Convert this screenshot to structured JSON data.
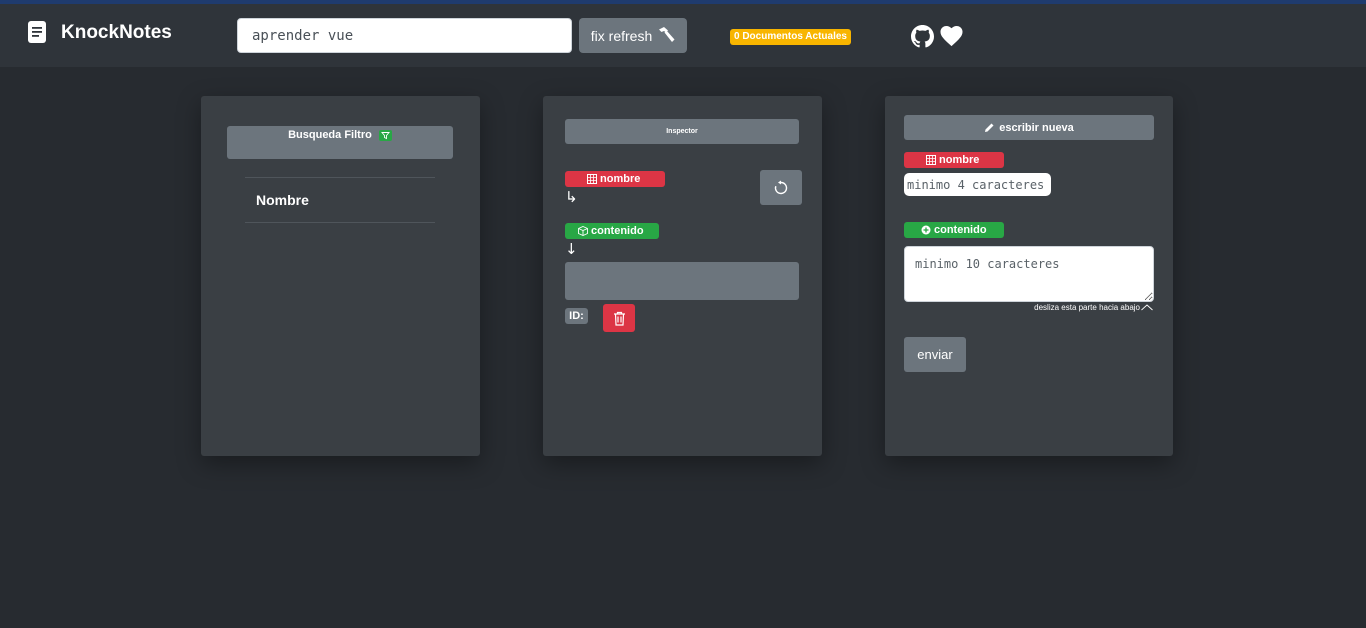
{
  "header": {
    "brand": "KnockNotes",
    "search_value": "aprender vue",
    "fix_label": "fix refresh",
    "docs_badge": "0 Documentos Actuales",
    "icons": [
      "document-icon",
      "hammer-icon",
      "github-icon",
      "heart-icon"
    ]
  },
  "filter_panel": {
    "button_label": "Busqueda Filtro",
    "column_header": "Nombre"
  },
  "inspector": {
    "title": "Inspector",
    "name_label": "nombre",
    "name_arrow": "↳",
    "content_label": "contenido",
    "content_arrow": "↓",
    "id_label": "ID:"
  },
  "editor": {
    "title": "escribir nueva",
    "name_label": "nombre",
    "name_placeholder": "minimo 4 caracteres",
    "content_label": "contenido",
    "content_placeholder": "minimo 10 caracteres",
    "scroll_hint": "desliza esta parte hacia abajo",
    "submit_label": "enviar"
  },
  "colors": {
    "background": "#272b30",
    "navbar": "#2f343a",
    "card": "#3a3f44",
    "secondary": "#6c757d",
    "danger": "#dc3545",
    "success": "#28a745",
    "warning": "#f8b500"
  }
}
